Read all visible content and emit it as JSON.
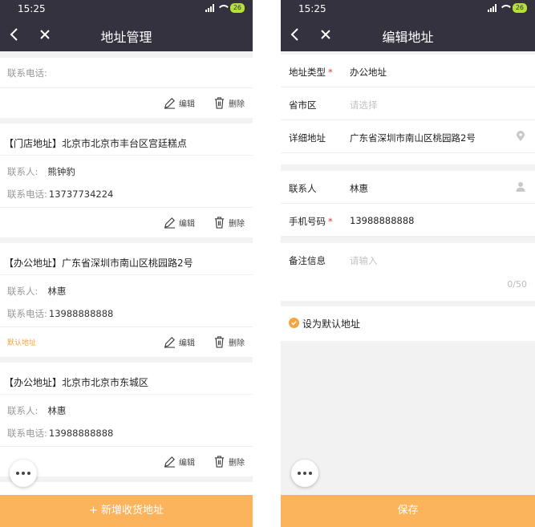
{
  "left": {
    "status_time": "15:25",
    "battery": "26",
    "title": "地址管理",
    "top_partial_label": "联系电话:",
    "edit_label": "编辑",
    "delete_label": "删除",
    "contact_label": "联系人:",
    "phone_label": "联系电话:",
    "addresses": [
      {
        "head": "【门店地址】北京市北京市丰台区宫廷糕点",
        "contact": "熊钟豹",
        "phone": "13737734224",
        "default": ""
      },
      {
        "head": "【办公地址】广东省深圳市南山区桃园路2号",
        "contact": "林惠",
        "phone": "13988888888",
        "default": "默认地址"
      },
      {
        "head": "【办公地址】北京市北京市东城区",
        "contact": "林惠",
        "phone": "13988888888",
        "default": ""
      }
    ],
    "add_button": "+ 新增收货地址"
  },
  "right": {
    "status_time": "15:25",
    "battery": "26",
    "title": "编辑地址",
    "type_label": "地址类型",
    "type_value": "办公地址",
    "region_label": "省市区",
    "region_placeholder": "请选择",
    "detail_label": "详细地址",
    "detail_value": "广东省深圳市南山区桃园路2号",
    "contact_label": "联系人",
    "contact_value": "林惠",
    "mobile_label": "手机号码",
    "mobile_value": "13988888888",
    "note_label": "备注信息",
    "note_placeholder": "请输入",
    "note_counter": "0/50",
    "default_label": "设为默认地址",
    "save_button": "保存",
    "required_mark": "*"
  },
  "colors": {
    "header": "#34323f",
    "accent": "#fbb45c",
    "default_tag": "#f5a442"
  },
  "icons": [
    "back-arrow-icon",
    "close-icon",
    "edit-pencil-icon",
    "trash-icon",
    "location-pin-icon",
    "person-icon",
    "check-icon",
    "more-dots-icon"
  ]
}
